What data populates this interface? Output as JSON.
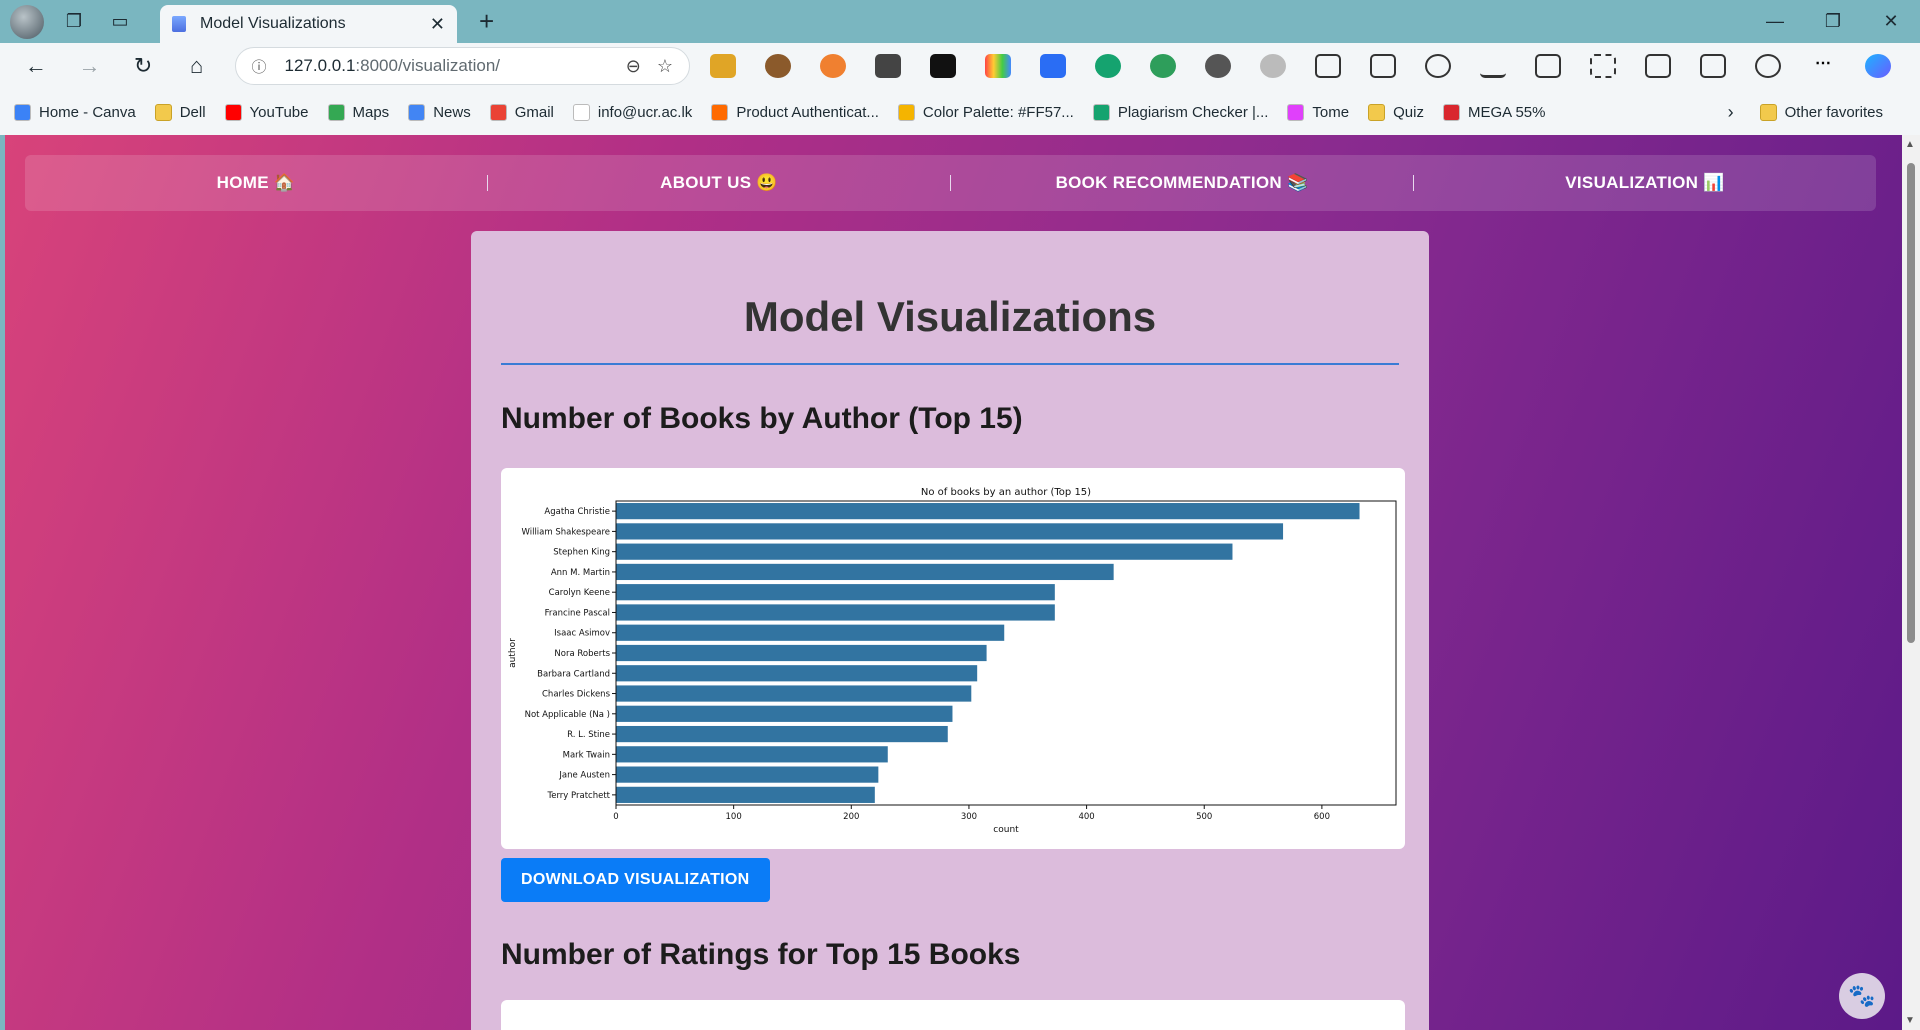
{
  "browser": {
    "tab_title": "Model Visualizations",
    "url_host": "127.0.0.1",
    "url_rest": ":8000/visualization/",
    "bookmarks": [
      {
        "label": "Home - Canva",
        "color": "#3b82f6"
      },
      {
        "label": "Dell",
        "color": "folder"
      },
      {
        "label": "YouTube",
        "color": "#ff0000"
      },
      {
        "label": "Maps",
        "color": "#34a853"
      },
      {
        "label": "News",
        "color": "#4285f4"
      },
      {
        "label": "Gmail",
        "color": "#ea4335"
      },
      {
        "label": "info@ucr.ac.lk",
        "color": "#ffffff"
      },
      {
        "label": "Product Authenticat...",
        "color": "#ff6a00"
      },
      {
        "label": "Color Palette: #FF57...",
        "color": "#f5b400"
      },
      {
        "label": "Plagiarism Checker |...",
        "color": "#15a36f"
      },
      {
        "label": "Tome",
        "color": "#e040fb"
      },
      {
        "label": "Quiz",
        "color": "folder"
      },
      {
        "label": "MEGA 55%",
        "color": "#d9272e"
      }
    ],
    "other_favorites": "Other favorites"
  },
  "nav": {
    "home": "HOME 🏠",
    "about": "ABOUT US 😃",
    "books": "BOOK RECOMMENDATION 📚",
    "viz": "VISUALIZATION 📊"
  },
  "page": {
    "title": "Model Visualizations",
    "section1": "Number of Books by Author (Top 15)",
    "download": "DOWNLOAD VISUALIZATION",
    "section2": "Number of Ratings for Top 15 Books"
  },
  "chart_data": {
    "type": "bar",
    "orientation": "horizontal",
    "title": "No of books by an author (Top 15)",
    "xlabel": "count",
    "ylabel": "author",
    "categories": [
      "Agatha Christie",
      "William Shakespeare",
      "Stephen King",
      "Ann M. Martin",
      "Carolyn Keene",
      "Francine Pascal",
      "Isaac Asimov",
      "Nora Roberts",
      "Barbara Cartland",
      "Charles Dickens",
      "Not Applicable (Na )",
      "R. L. Stine",
      "Mark Twain",
      "Jane Austen",
      "Terry Pratchett"
    ],
    "values": [
      632,
      567,
      524,
      423,
      373,
      373,
      330,
      315,
      307,
      302,
      286,
      282,
      231,
      223,
      220
    ],
    "xlim": [
      0,
      663
    ],
    "xticks": [
      0,
      100,
      200,
      300,
      400,
      500,
      600
    ],
    "bar_color": "#3274a1"
  }
}
